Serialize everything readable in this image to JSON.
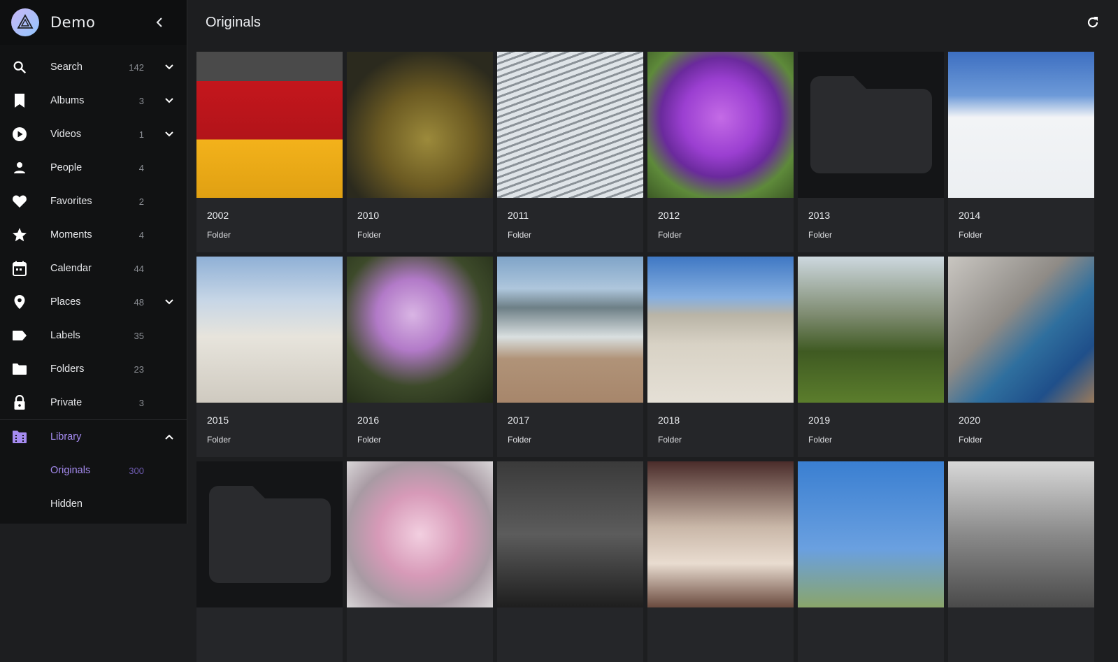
{
  "brand": {
    "name": "Demo"
  },
  "sidebar": {
    "items": [
      {
        "label": "Search",
        "count": "142",
        "icon": "search-icon",
        "chevron": "down"
      },
      {
        "label": "Albums",
        "count": "3",
        "icon": "bookmark-icon",
        "chevron": "down"
      },
      {
        "label": "Videos",
        "count": "1",
        "icon": "play-circle-icon",
        "chevron": "down"
      },
      {
        "label": "People",
        "count": "4",
        "icon": "person-icon",
        "chevron": ""
      },
      {
        "label": "Favorites",
        "count": "2",
        "icon": "heart-icon",
        "chevron": ""
      },
      {
        "label": "Moments",
        "count": "4",
        "icon": "star-icon",
        "chevron": ""
      },
      {
        "label": "Calendar",
        "count": "44",
        "icon": "calendar-icon",
        "chevron": ""
      },
      {
        "label": "Places",
        "count": "48",
        "icon": "place-pin-icon",
        "chevron": "down"
      },
      {
        "label": "Labels",
        "count": "35",
        "icon": "label-tag-icon",
        "chevron": ""
      },
      {
        "label": "Folders",
        "count": "23",
        "icon": "folder-icon",
        "chevron": ""
      },
      {
        "label": "Private",
        "count": "3",
        "icon": "lock-icon",
        "chevron": ""
      }
    ],
    "library": {
      "label": "Library",
      "icon": "library-folder-icon",
      "chevron": "up",
      "accent": "#a58bf0"
    },
    "library_sub": [
      {
        "label": "Originals",
        "count": "300",
        "active": true
      },
      {
        "label": "Hidden",
        "count": "",
        "active": false
      }
    ]
  },
  "toolbar": {
    "title": "Originals",
    "refresh_icon": "refresh-icon"
  },
  "folders": [
    {
      "title": "2002",
      "subtitle": "Folder"
    },
    {
      "title": "2010",
      "subtitle": "Folder"
    },
    {
      "title": "2011",
      "subtitle": "Folder"
    },
    {
      "title": "2012",
      "subtitle": "Folder"
    },
    {
      "title": "2013",
      "subtitle": "Folder"
    },
    {
      "title": "2014",
      "subtitle": "Folder"
    },
    {
      "title": "2015",
      "subtitle": "Folder"
    },
    {
      "title": "2016",
      "subtitle": "Folder"
    },
    {
      "title": "2017",
      "subtitle": "Folder"
    },
    {
      "title": "2018",
      "subtitle": "Folder"
    },
    {
      "title": "2019",
      "subtitle": "Folder"
    },
    {
      "title": "2020",
      "subtitle": "Folder"
    }
  ],
  "colors": {
    "background": "#1d1e20",
    "sidebar": "#111213",
    "card": "#252629",
    "accent": "#a58bf0"
  }
}
